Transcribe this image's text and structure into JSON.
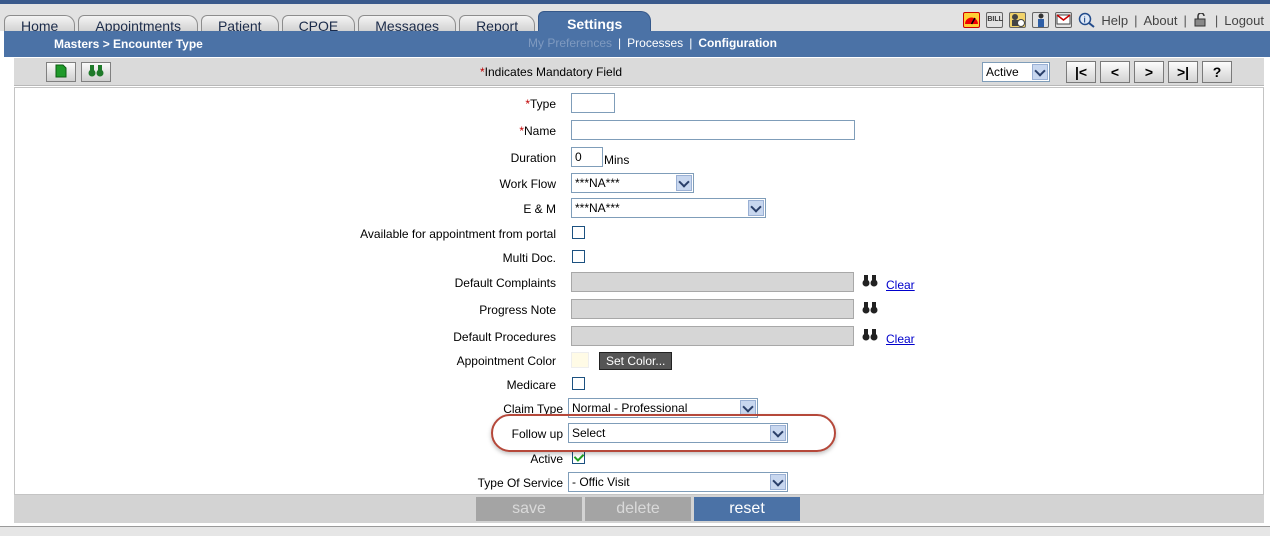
{
  "tabs": [
    {
      "label": "Home"
    },
    {
      "label": "Appointments"
    },
    {
      "label": "Patient"
    },
    {
      "label": "CPOE"
    },
    {
      "label": "Messages"
    },
    {
      "label": "Report"
    },
    {
      "label": "Settings",
      "active": true
    }
  ],
  "utility": {
    "icons": [
      "dashboard-icon",
      "bill-icon",
      "user-clock-icon",
      "doctor-icon",
      "mail-icon",
      "info-search-icon"
    ],
    "bill_text": "BILL",
    "help": "Help",
    "about": "About",
    "logout": "Logout"
  },
  "header": {
    "breadcrumb": "Masters > Encounter Type",
    "subnav": {
      "my_preferences": "My Preferences",
      "processes": "Processes",
      "configuration": "Configuration",
      "sep": "|"
    }
  },
  "toolbar": {
    "mandatory_star": "*",
    "mandatory_text": "Indicates Mandatory Field",
    "status_value": "Active",
    "nav": [
      "|<",
      "<",
      ">",
      ">|",
      "?"
    ]
  },
  "form": {
    "type": {
      "label": "Type",
      "value": ""
    },
    "name": {
      "label": "Name",
      "value": ""
    },
    "duration": {
      "label": "Duration",
      "value": "0",
      "unit": "Mins"
    },
    "work_flow": {
      "label": "Work Flow",
      "value": "***NA***"
    },
    "e_m": {
      "label": "E & M",
      "value": "***NA***"
    },
    "portal": {
      "label": "Available for appointment from portal",
      "checked": false
    },
    "multi_doc": {
      "label": "Multi Doc.",
      "checked": false
    },
    "default_complaints": {
      "label": "Default Complaints",
      "value": "",
      "clear": "Clear"
    },
    "progress_note": {
      "label": "Progress Note",
      "value": ""
    },
    "default_procedures": {
      "label": "Default Procedures",
      "value": "",
      "clear": "Clear"
    },
    "appointment_color": {
      "label": "Appointment Color",
      "button": "Set Color...",
      "color": "#fffbe6"
    },
    "medicare": {
      "label": "Medicare",
      "checked": false
    },
    "claim_type": {
      "label": "Claim Type",
      "value": "Normal - Professional"
    },
    "follow_up": {
      "label": "Follow up",
      "value": "Select"
    },
    "active": {
      "label": "Active",
      "checked": true
    },
    "type_of_service": {
      "label": "Type Of Service",
      "value": "- Offic Visit"
    }
  },
  "actions": {
    "save": "save",
    "delete": "delete",
    "reset": "reset"
  },
  "colors": {
    "accent": "#4b72a6",
    "mandatory": "#c00000",
    "highlight": "#b5483a"
  }
}
